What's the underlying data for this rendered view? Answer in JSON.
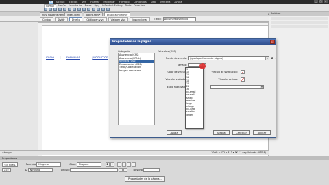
{
  "menubar": {
    "logo": "Dw",
    "items": [
      "Archivo",
      "Edición",
      "Ver",
      "Insertar",
      "Modificar",
      "Formato",
      "Comandos",
      "Sitio",
      "Ventana",
      "Ayuda"
    ],
    "window_controls": [
      "_",
      "□",
      "×"
    ]
  },
  "insert_tabs": [
    "Común",
    "Diseño",
    "Formularios",
    "Datos",
    "Spry",
    "InContext Editing",
    "Texto",
    "Favoritos"
  ],
  "doc_tabs": [
    "nav_nosotros.html",
    "index.html",
    "pbprx.html*",
    "practica_htl.html*"
  ],
  "doc_path": "C:\\Users\\Documents\\practica\\practica_htl.html",
  "doc_toolbar": {
    "code": "Código",
    "split": "Dividir",
    "design": "Diseño",
    "live_code": "Código en vivo",
    "live_view": "Vista en vivo",
    "inspect": "Inspeccionar",
    "title_label": "Título:",
    "title_value": "Documento sin título"
  },
  "canvas": {
    "links": [
      "inicio",
      "servicios",
      "productos"
    ],
    "separators": [
      "|",
      "|"
    ]
  },
  "right_panel": {
    "header": "Archivos"
  },
  "statusbar": {
    "left": "<body>",
    "right": "100% ▾ 832 x 313 ▾ 1K / 1 seg Unicode (UTF-8)"
  },
  "dialog": {
    "title": "Propiedades de la página",
    "close": "×",
    "category_title": "Categoría",
    "categories": [
      "Apariencia (CSS)",
      "Apariencia (HTML)",
      "Vínculos (CSS)",
      "Encabezados (CSS)",
      "Título/Codificación",
      "Imagen de rastreo"
    ],
    "selected_category": "Vínculos (CSS)",
    "section_title": "Vínculos (CSS)",
    "fields": {
      "font_label": "Fuente de vínculo:",
      "font_value": "(Igual que fuente de página)",
      "size_label": "Tamaño:",
      "color_label": "Color de vínculo:",
      "visited_label": "Vínculos visitados:",
      "rollover_label": "Vínculo de sustitución:",
      "active_label": "Vínculos activos:",
      "underline_label": "Estilo subrayado:",
      "bold": "B",
      "italic": "I"
    },
    "size_options": [
      "9",
      "10",
      "12",
      "14",
      "16",
      "18",
      "24",
      "36",
      "xx-small",
      "x-small",
      "small",
      "medium",
      "large",
      "x-large",
      "xx-large",
      "smaller",
      "larger"
    ],
    "buttons": {
      "help": "Ayuda",
      "ok": "Aceptar",
      "cancel": "Cancelar",
      "apply": "Aplicar"
    }
  },
  "properties": {
    "header": "Propiedades",
    "html_chip": "<> HTML",
    "css_chip": "CSS",
    "format_label": "Formato",
    "format_value": "Ninguno",
    "class_label": "Clase",
    "class_value": "Ninguno",
    "id_label": "ID",
    "id_value": "Ninguno",
    "link_label": "Vínculo",
    "target_label": "Destino",
    "bold": "B",
    "italic": "I",
    "page_props_button": "Propiedades de la página..."
  }
}
